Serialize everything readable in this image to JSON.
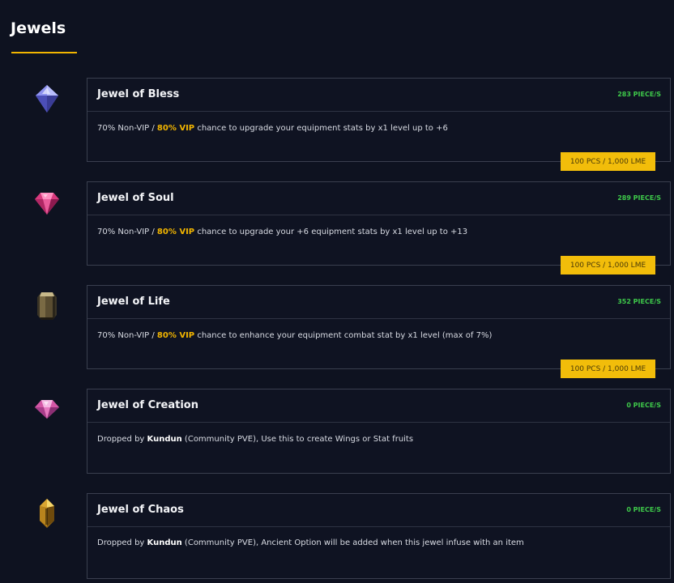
{
  "page": {
    "title": "Jewels"
  },
  "jewels": [
    {
      "name": "Jewel of Bless",
      "count": "283 PIECE/S",
      "desc_pre": "70% Non-VIP / ",
      "desc_vip": "80% VIP",
      "desc_post": " chance to upgrade your equipment stats by x1 level up to +6",
      "button": "100 PCS / 1,000 LME",
      "icon": "bless-jewel-icon"
    },
    {
      "name": "Jewel of Soul",
      "count": "289 PIECE/S",
      "desc_pre": "70% Non-VIP / ",
      "desc_vip": "80% VIP",
      "desc_post": " chance to upgrade your +6 equipment stats by x1 level up to +13",
      "button": "100 PCS / 1,000 LME",
      "icon": "soul-jewel-icon"
    },
    {
      "name": "Jewel of Life",
      "count": "352 PIECE/S",
      "desc_pre": "70% Non-VIP / ",
      "desc_vip": "80% VIP",
      "desc_post": " chance to enhance your equipment combat stat by x1 level (max of 7%)",
      "button": "100 PCS / 1,000 LME",
      "icon": "life-jewel-icon"
    },
    {
      "name": "Jewel of Creation",
      "count": "0 PIECE/S",
      "desc_pre": "Dropped by ",
      "desc_boss": "Kundun",
      "desc_post": " (Community PVE), Use this to create Wings or Stat fruits",
      "icon": "creation-jewel-icon"
    },
    {
      "name": "Jewel of Chaos",
      "count": "0 PIECE/S",
      "desc_pre": "Dropped by ",
      "desc_boss": "Kundun",
      "desc_post": " (Community PVE), Ancient Option will be added when this jewel infuse with an item",
      "icon": "chaos-jewel-icon"
    }
  ]
}
